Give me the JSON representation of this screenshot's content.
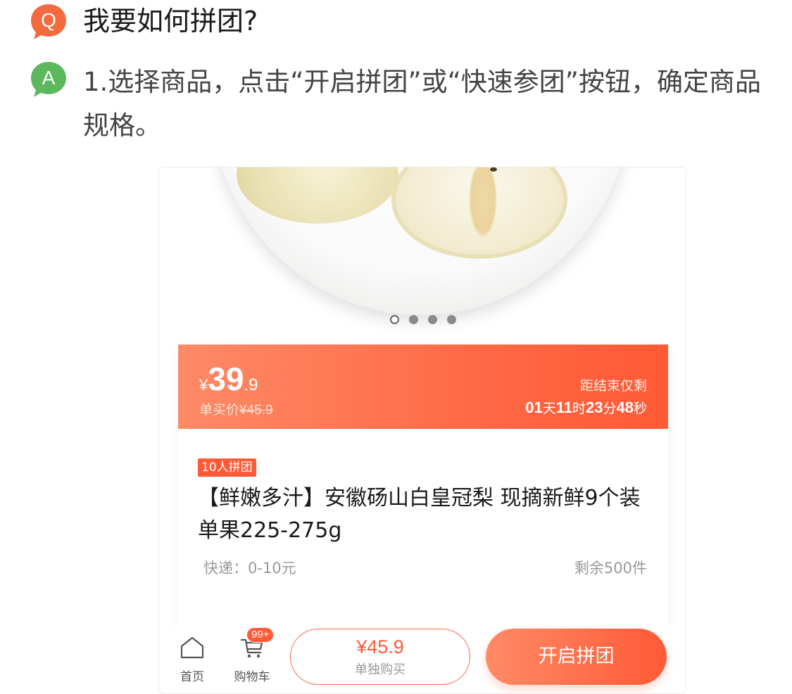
{
  "faq": {
    "question_badge": "Q",
    "question": "我要如何拼团?",
    "answer_badge": "A",
    "answer": "1.选择商品，点击“开启拼团”或“快速参团”按钮，确定商品规格。"
  },
  "product": {
    "carousel": {
      "count": 4,
      "active_index": 0
    },
    "price": {
      "currency": "¥",
      "integer": "39",
      "decimal": ".9"
    },
    "original_price": {
      "label": "单买价",
      "value": "¥45.9"
    },
    "countdown": {
      "label": "距结束仅剩",
      "days": "01",
      "days_unit": "天",
      "hours": "11",
      "hours_unit": "时",
      "minutes": "23",
      "minutes_unit": "分",
      "seconds": "48",
      "seconds_unit": "秒"
    },
    "group_tag": "10人拼团",
    "title": "【鲜嫩多汁】安徽砀山白皇冠梨 现摘新鲜9个装 单果225-275g",
    "shipping": "快递：0-10元",
    "stock": "剩余500件"
  },
  "bottom_bar": {
    "home_label": "首页",
    "cart_label": "购物车",
    "cart_badge": "99+",
    "solo_price": "¥45.9",
    "solo_label": "单独购买",
    "group_button": "开启拼团"
  },
  "colors": {
    "q_badge": "#f26a3d",
    "a_badge": "#5cb85c",
    "accent": "#ff5a36"
  }
}
